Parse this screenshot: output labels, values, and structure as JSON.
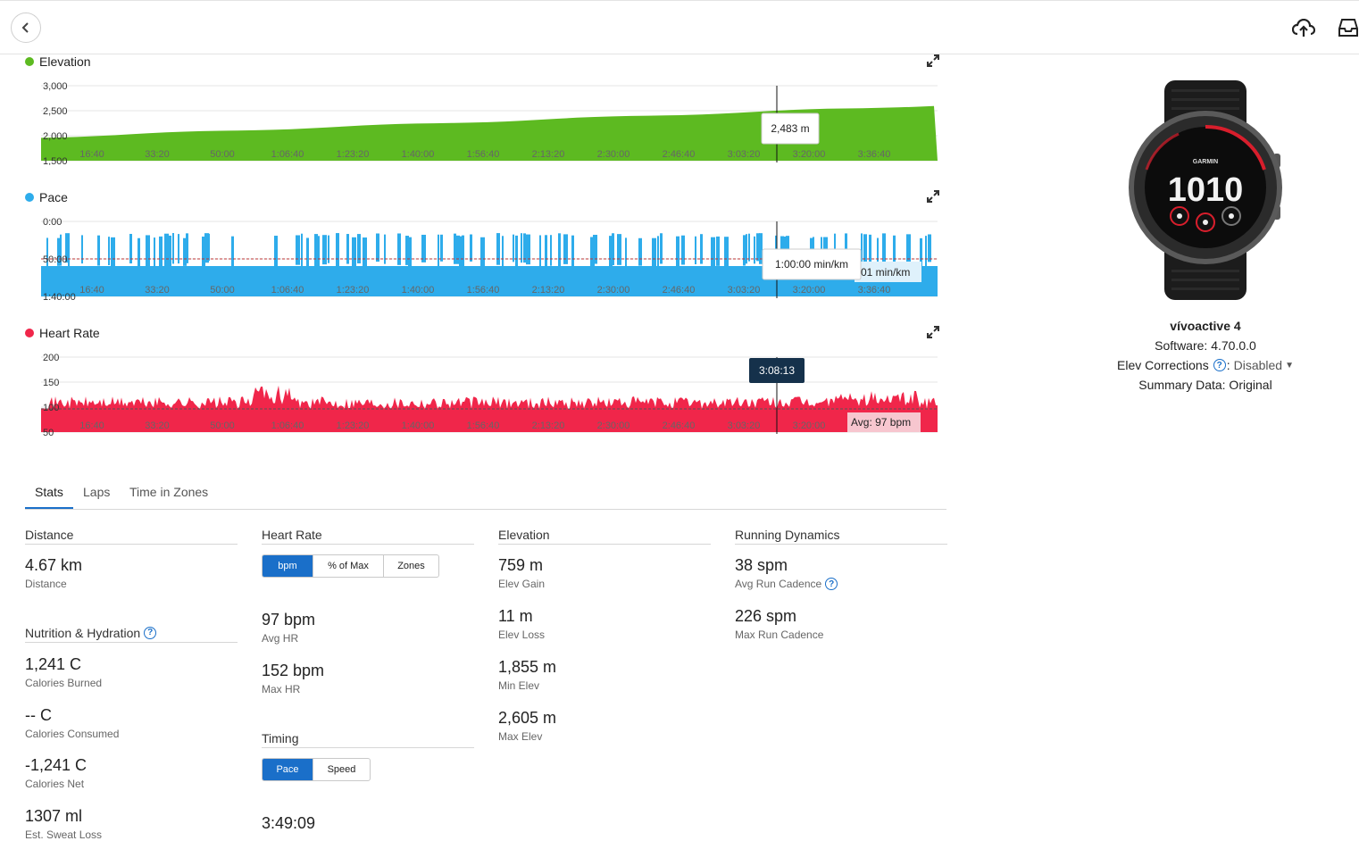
{
  "charts": {
    "elevation": {
      "label": "Elevation",
      "color": "#5dba21",
      "y_ticks": [
        "3,000",
        "2,500",
        "2,000",
        "1,500"
      ],
      "x_ticks": [
        "16:40",
        "33:20",
        "50:00",
        "1:06:40",
        "1:23:20",
        "1:40:00",
        "1:56:40",
        "2:13:20",
        "2:30:00",
        "2:46:40",
        "3:03:20",
        "3:20:00",
        "3:36:40"
      ],
      "tooltip": "2,483 m"
    },
    "pace": {
      "label": "Pace",
      "color": "#2eaceb",
      "y_ticks": [
        "0:00",
        "50:00",
        "1:40:00"
      ],
      "x_ticks": [
        "16:40",
        "33:20",
        "50:00",
        "1:06:40",
        "1:23:20",
        "1:40:00",
        "1:56:40",
        "2:13:20",
        "2:30:00",
        "2:46:40",
        "3:03:20",
        "3:20:00",
        "3:36:40"
      ],
      "tooltip": "1:00:00 min/km",
      "avg_partial": "01 min/km"
    },
    "heart_rate": {
      "label": "Heart Rate",
      "color": "#f0264a",
      "y_ticks": [
        "200",
        "150",
        "100",
        "50"
      ],
      "x_ticks": [
        "16:40",
        "33:20",
        "50:00",
        "1:06:40",
        "1:23:20",
        "1:40:00",
        "1:56:40",
        "2:13:20",
        "2:30:00",
        "2:46:40",
        "3:03:20",
        "3:20:00",
        "3:36:40"
      ],
      "cursor_time": "3:08:13",
      "avg_label": "Avg: 97 bpm"
    }
  },
  "tabs": [
    "Stats",
    "Laps",
    "Time in Zones"
  ],
  "stats": {
    "distance": {
      "title": "Distance",
      "value": "4.67 km",
      "label": "Distance"
    },
    "nutrition": {
      "title": "Nutrition & Hydration",
      "items": [
        {
          "value": "1,241 C",
          "label": "Calories Burned"
        },
        {
          "value": "-- C",
          "label": "Calories Consumed"
        },
        {
          "value": "-1,241 C",
          "label": "Calories Net"
        },
        {
          "value": "1307 ml",
          "label": "Est. Sweat Loss"
        }
      ]
    },
    "heart_rate": {
      "title": "Heart Rate",
      "toggle": [
        "bpm",
        "% of Max",
        "Zones"
      ],
      "items": [
        {
          "value": "97 bpm",
          "label": "Avg HR"
        },
        {
          "value": "152 bpm",
          "label": "Max HR"
        }
      ]
    },
    "timing": {
      "title": "Timing",
      "toggle": [
        "Pace",
        "Speed"
      ],
      "items": [
        {
          "value": "3:49:09"
        }
      ]
    },
    "elevation": {
      "title": "Elevation",
      "items": [
        {
          "value": "759 m",
          "label": "Elev Gain"
        },
        {
          "value": "11 m",
          "label": "Elev Loss"
        },
        {
          "value": "1,855 m",
          "label": "Min Elev"
        },
        {
          "value": "2,605 m",
          "label": "Max Elev"
        }
      ]
    },
    "running_dynamics": {
      "title": "Running Dynamics",
      "items": [
        {
          "value": "38 spm",
          "label": "Avg Run Cadence"
        },
        {
          "value": "226 spm",
          "label": "Max Run Cadence"
        }
      ]
    }
  },
  "device": {
    "brand": "GARMIN",
    "face_time": "1010",
    "name": "vívoactive 4",
    "software": "Software: 4.70.0.0",
    "elev_corrections_label": "Elev Corrections",
    "elev_corrections_value": "Disabled",
    "summary_data": "Summary Data: Original"
  }
}
